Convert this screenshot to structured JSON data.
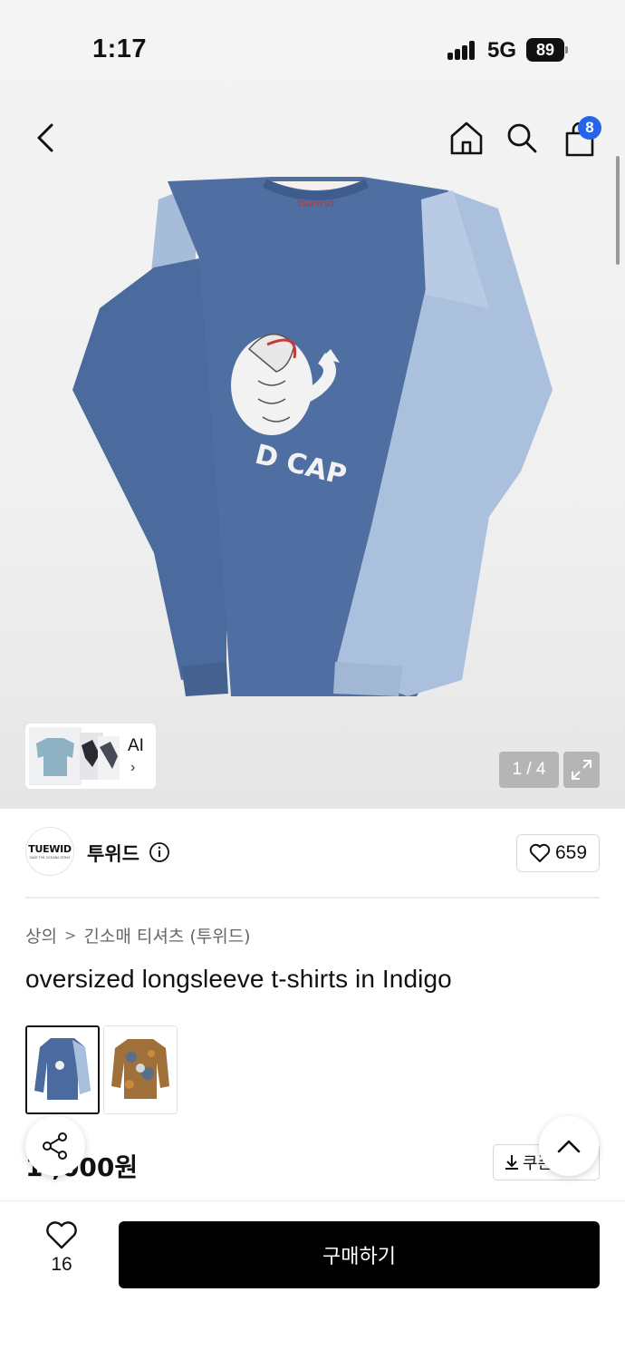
{
  "status_bar": {
    "time": "1:17",
    "network": "5G",
    "battery": "89"
  },
  "header": {
    "cart_count": "8",
    "icons": [
      "back-icon",
      "home-icon",
      "search-icon",
      "cart-icon"
    ]
  },
  "gallery": {
    "ai_label": "AI",
    "ai_chevron": "›",
    "page_counter": "1 / 4",
    "image_print_text": "D CAP",
    "image_tag_text": "tuewid"
  },
  "brand": {
    "logo_text": "TUEWID",
    "logo_subtext": "SAVE THE OCEANS STRAY",
    "name": "투위드",
    "likes": "659"
  },
  "breadcrumb": {
    "category": "상의",
    "separator": ">",
    "subcategory": "긴소매 티셔츠 (투위드)"
  },
  "product": {
    "title": "oversized longsleeve t-shirts in Indigo",
    "price": "1 ,000원",
    "coupon_label": "쿠폰"
  },
  "bottom_bar": {
    "wish_count": "16",
    "buy_label": "구매하기"
  },
  "colors": {
    "badge": "#2563eb",
    "buy_button": "#000000",
    "indigo_body": "#4a6a9e",
    "light_sleeve": "#a9bfdc"
  }
}
